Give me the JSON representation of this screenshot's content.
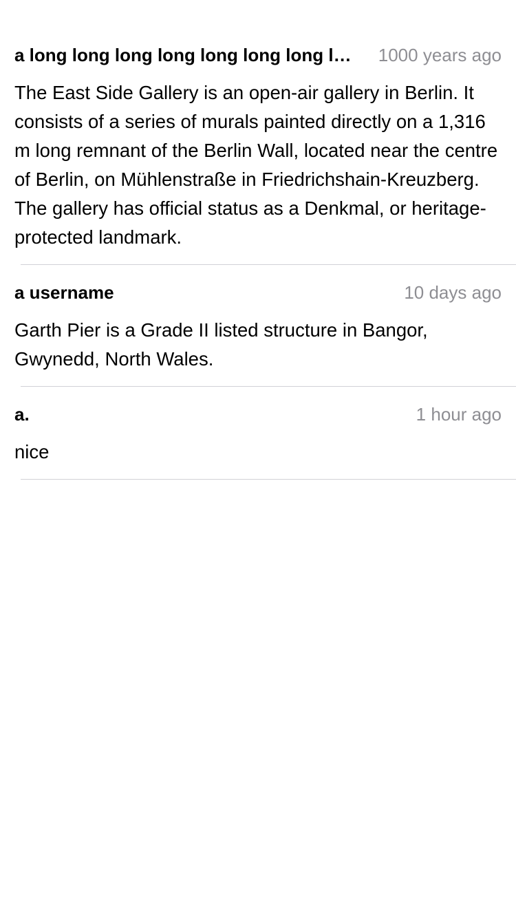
{
  "comments": [
    {
      "username": "a long long long long long long long long long username",
      "time": "1000 years ago",
      "text": "The East Side Gallery is an open-air gallery in Berlin. It consists of a series of murals painted directly on a 1,316 m long remnant of the Berlin Wall, located near the centre of Berlin, on Mühlenstraße in Friedrichshain-Kreuzberg. The gallery has official status as a Denkmal, or heritage-protected landmark."
    },
    {
      "username": "a username",
      "time": "10 days ago",
      "text": "Garth Pier is a Grade II listed structure in Bangor, Gwynedd, North Wales."
    },
    {
      "username": "a.",
      "time": "1 hour ago",
      "text": "nice"
    }
  ]
}
